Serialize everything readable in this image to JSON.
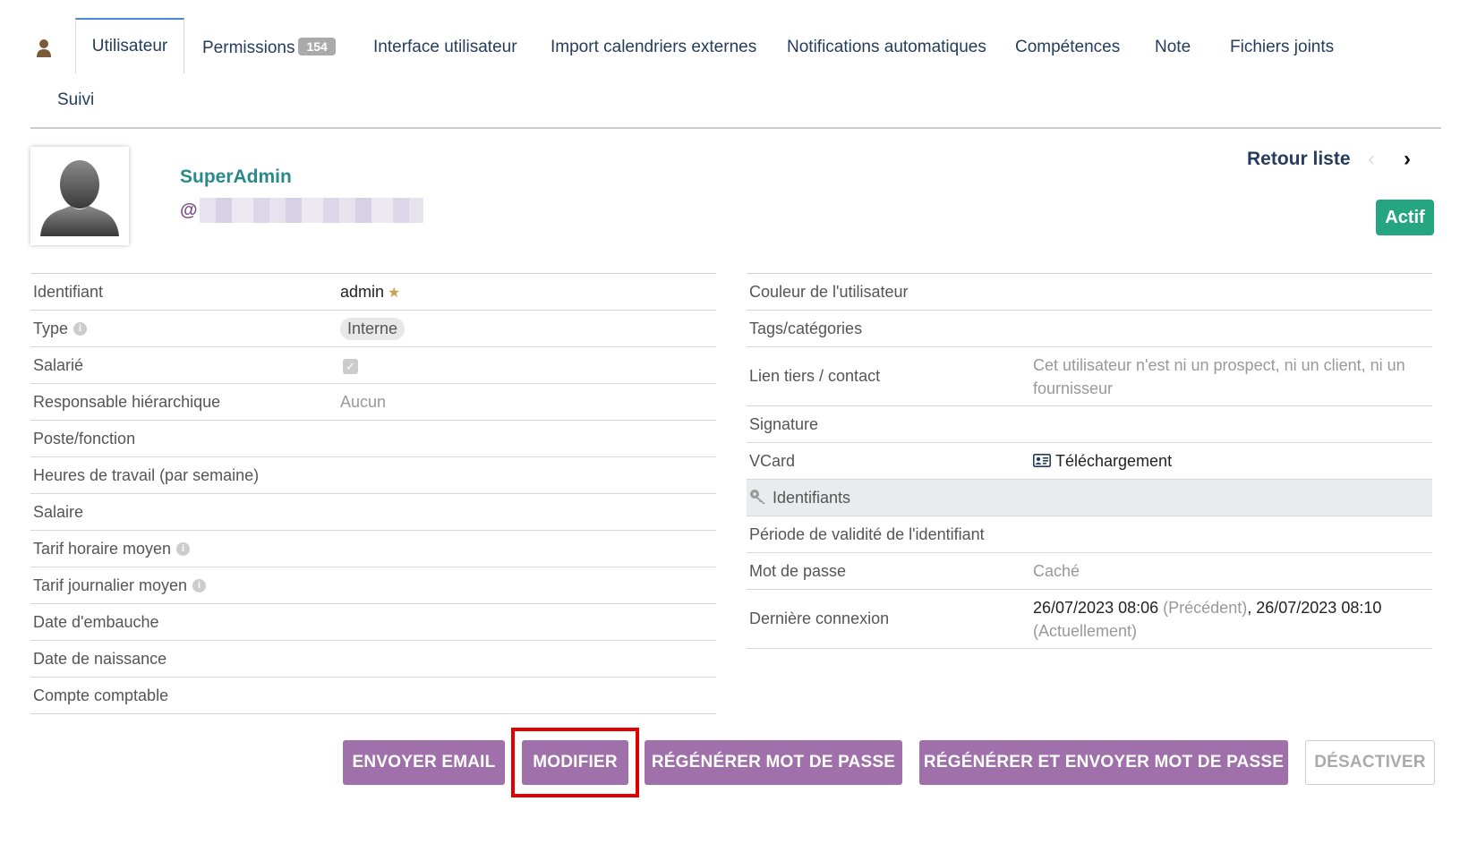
{
  "tabs": {
    "user_icon": "user-icon",
    "items": [
      {
        "label": "Utilisateur"
      },
      {
        "label": "Permissions",
        "badge": "154"
      },
      {
        "label": "Interface utilisateur"
      },
      {
        "label": "Import calendriers externes"
      },
      {
        "label": "Notifications automatiques"
      },
      {
        "label": "Compétences"
      },
      {
        "label": "Note"
      },
      {
        "label": "Fichiers joints"
      },
      {
        "label": "Suivi"
      }
    ]
  },
  "header": {
    "username": "SuperAdmin",
    "at": "@",
    "back_label": "Retour liste",
    "prev_icon": "‹",
    "next_icon": "›",
    "status": "Actif"
  },
  "left": {
    "identifiant": {
      "label": "Identifiant",
      "value": "admin"
    },
    "type": {
      "label": "Type",
      "value": "Interne"
    },
    "salarie": {
      "label": "Salarié"
    },
    "responsable": {
      "label": "Responsable hiérarchique",
      "value": "Aucun"
    },
    "poste": {
      "label": "Poste/fonction"
    },
    "heures": {
      "label": "Heures de travail (par semaine)"
    },
    "salaire": {
      "label": "Salaire"
    },
    "tarif_horaire": {
      "label": "Tarif horaire moyen"
    },
    "tarif_journalier": {
      "label": "Tarif journalier moyen"
    },
    "embauche": {
      "label": "Date d'embauche"
    },
    "naissance": {
      "label": "Date de naissance"
    },
    "compte": {
      "label": "Compte comptable"
    }
  },
  "right": {
    "couleur": {
      "label": "Couleur de l'utilisateur"
    },
    "tags": {
      "label": "Tags/catégories"
    },
    "lien": {
      "label": "Lien tiers / contact",
      "value": "Cet utilisateur n'est ni un prospect, ni un client, ni un fournisseur"
    },
    "signature": {
      "label": "Signature"
    },
    "vcard": {
      "label": "VCard",
      "value": "Téléchargement"
    },
    "identifiants_section": {
      "label": "Identifiants"
    },
    "periode": {
      "label": "Période de validité de l'identifiant"
    },
    "motdepasse": {
      "label": "Mot de passe",
      "value": "Caché"
    },
    "derniere": {
      "label": "Dernière connexion",
      "date1": "26/07/2023 08:06",
      "note1": "(Précédent)",
      "sep": ",",
      "date2": "26/07/2023 08:10",
      "note2": "(Actuellement)"
    }
  },
  "buttons": {
    "email": "ENVOYER EMAIL",
    "modifier": "MODIFIER",
    "regen": "RÉGÉNÉRER MOT DE PASSE",
    "regen_send": "RÉGÉNÉRER ET ENVOYER MOT DE PASSE",
    "desactiver": "DÉSACTIVER"
  },
  "colors": {
    "accent_purple": "#a070aa",
    "status_green": "#25a580",
    "username_teal": "#2a8a8a",
    "highlight_red": "#e00000"
  }
}
